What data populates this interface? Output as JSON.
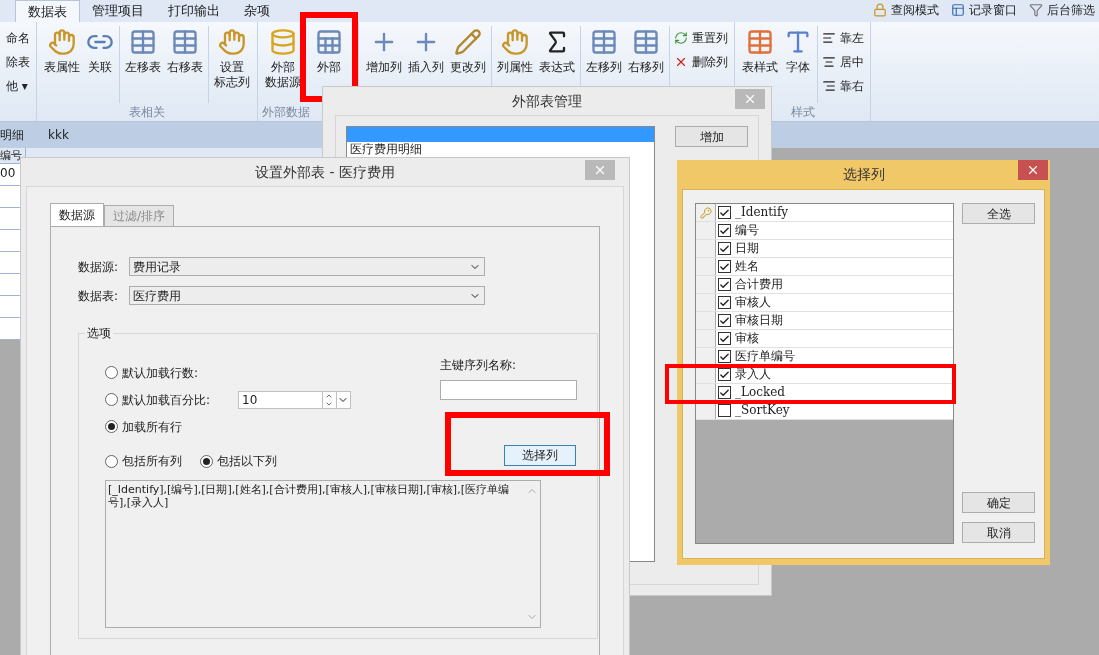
{
  "menu_tabs": [
    {
      "label": "数据表",
      "selected": true
    },
    {
      "label": "管理项目",
      "selected": false
    },
    {
      "label": "打印输出",
      "selected": false
    },
    {
      "label": "杂项",
      "selected": false
    }
  ],
  "quick_actions": [
    {
      "kind": "lock",
      "label": "查阅模式"
    },
    {
      "kind": "window",
      "label": "记录窗口"
    },
    {
      "kind": "filter",
      "label": "后台筛选"
    }
  ],
  "ribbon": {
    "groups": [
      {
        "sections": [
          [
            {
              "kind": "plain",
              "label": "命名"
            },
            {
              "kind": "plain",
              "label": "除表"
            },
            {
              "kind": "plain",
              "label": "他 ▾"
            }
          ]
        ]
      },
      {
        "label": "表相关",
        "sections": [
          [
            {
              "kind": "props",
              "lines": [
                "表属性"
              ]
            },
            {
              "kind": "link",
              "lines": [
                "关联"
              ]
            }
          ],
          [
            {
              "kind": "tableleft",
              "lines": [
                "左移表"
              ]
            },
            {
              "kind": "tableright",
              "lines": [
                "右移表"
              ]
            }
          ],
          [
            {
              "kind": "props",
              "lines": [
                "设置",
                "标志列"
              ]
            }
          ]
        ]
      },
      {
        "label": "外部数据",
        "sections": [
          [
            {
              "kind": "db",
              "lines": [
                "外部",
                "数据源"
              ]
            },
            {
              "kind": "dbtable",
              "lines": [
                "外部"
              ]
            }
          ]
        ]
      },
      {
        "sections": [
          [
            {
              "kind": "colnew",
              "lines": [
                "增加列"
              ]
            },
            {
              "kind": "colnew",
              "lines": [
                "插入列"
              ]
            },
            {
              "kind": "coledit",
              "lines": [
                "更改列"
              ]
            }
          ],
          [
            {
              "kind": "props",
              "lines": [
                "列属性"
              ]
            },
            {
              "kind": "fx",
              "lines": [
                "表达式"
              ]
            }
          ],
          [
            {
              "kind": "tableleft",
              "lines": [
                "左移列"
              ]
            },
            {
              "kind": "tableright",
              "lines": [
                "右移列"
              ]
            }
          ],
          [
            {
              "kind": "reset",
              "label": "重置列"
            },
            {
              "kind": "delete",
              "label": "删除列"
            }
          ]
        ]
      },
      {
        "label": "样式",
        "sections": [
          [
            {
              "kind": "style",
              "lines": [
                "表样式"
              ]
            },
            {
              "kind": "font",
              "lines": [
                "字体"
              ]
            }
          ],
          [
            {
              "kind": "alignleft",
              "label": "靠左"
            },
            {
              "kind": "aligncenter",
              "label": "居中"
            },
            {
              "kind": "alignright",
              "label": "靠右"
            }
          ]
        ]
      }
    ]
  },
  "sheet_tabs": [
    "明细",
    "kkk"
  ],
  "table": {
    "columns": [
      "编号"
    ],
    "rows": [
      [
        "00"
      ],
      [
        ""
      ],
      [
        ""
      ],
      [
        ""
      ],
      [
        ""
      ],
      [
        ""
      ],
      [
        ""
      ],
      [
        ""
      ]
    ]
  },
  "manager_dialog": {
    "title": "外部表管理",
    "items": [
      {
        "selected": true
      },
      {
        "label": "医疗费用明细",
        "selected": false
      }
    ],
    "buttons": [
      "增加"
    ]
  },
  "settings_dialog": {
    "title": "设置外部表 - 医疗费用",
    "tabs": [
      {
        "label": "数据源",
        "selected": true
      },
      {
        "label": "过滤/排序",
        "selected": false
      }
    ],
    "fields": [
      {
        "label": "数据源:",
        "value": "费用记录"
      },
      {
        "label": "数据表:",
        "value": "医疗费用"
      }
    ],
    "options_title": "选项",
    "row_options": [
      {
        "label": "默认加载行数:",
        "selected": false
      },
      {
        "label": "默认加载百分比:",
        "selected": false,
        "spinner": "10"
      },
      {
        "label": "加载所有行",
        "selected": true
      }
    ],
    "key_label": "主键序列名称:",
    "column_options": [
      {
        "label": "包括所有列",
        "selected": false
      },
      {
        "label": "包括以下列",
        "selected": true
      }
    ],
    "choose_button": "选择列",
    "columns_text": "[_Identify],[编号],[日期],[姓名],[合计费用],[审核人],[审核日期],[审核],[医疗单编号],[录入人]"
  },
  "columns_dialog": {
    "title": "选择列",
    "rows": [
      {
        "label": "_Identify",
        "checked": true,
        "key": true
      },
      {
        "label": "编号",
        "checked": true,
        "key": false
      },
      {
        "label": "日期",
        "checked": true,
        "key": false
      },
      {
        "label": "姓名",
        "checked": true,
        "key": false
      },
      {
        "label": "合计费用",
        "checked": true,
        "key": false
      },
      {
        "label": "审核人",
        "checked": true,
        "key": false
      },
      {
        "label": "审核日期",
        "checked": true,
        "key": false
      },
      {
        "label": "审核",
        "checked": true,
        "key": false
      },
      {
        "label": "医疗单编号",
        "checked": true,
        "key": false
      },
      {
        "label": "录入人",
        "checked": true,
        "key": false
      },
      {
        "label": "_Locked",
        "checked": true,
        "key": false
      },
      {
        "label": "_SortKey",
        "checked": false,
        "key": false
      }
    ],
    "select_all": "全选",
    "ok": "确定",
    "cancel": "取消"
  }
}
